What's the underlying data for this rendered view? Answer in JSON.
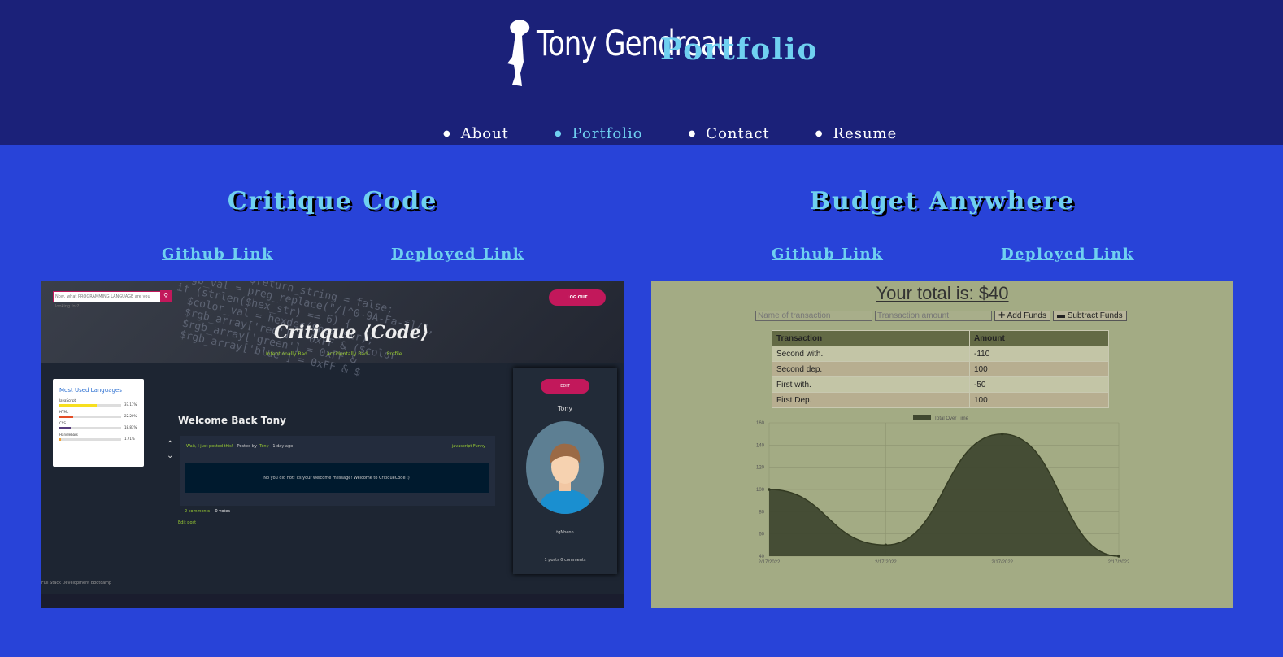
{
  "header": {
    "logo_text": "Tony Gendreau",
    "title": "Portfolio"
  },
  "nav": {
    "items": [
      {
        "label": "About"
      },
      {
        "label": "Portfolio"
      },
      {
        "label": "Contact"
      },
      {
        "label": "Resume"
      }
    ],
    "active": "Portfolio"
  },
  "projects": [
    {
      "title": "Critique Code",
      "github_label": "Github Link",
      "deployed_label": "Deployed Link"
    },
    {
      "title": "Budget Anywhere",
      "github_label": "Github Link",
      "deployed_label": "Deployed Link"
    }
  ],
  "critique_screenshot": {
    "search_placeholder": "Now, what PROGRAMMING LANGUAGE are you looking for?",
    "logout_label": "LOG OUT",
    "brand": "Critique ⟨Code⟩",
    "nav_links": [
      "Intentionally Bad",
      "Accidentally Bad",
      "Profile"
    ],
    "sidebar_title": "Most Used Languages",
    "languages": [
      {
        "name": "JavaScript",
        "pct": "37.17%",
        "fill": 0.6,
        "color": "#f7df1e"
      },
      {
        "name": "HTML",
        "pct": "22.20%",
        "fill": 0.22,
        "color": "#e44d26"
      },
      {
        "name": "CSS",
        "pct": "18.83%",
        "fill": 0.18,
        "color": "#563d7c"
      },
      {
        "name": "Handlebars",
        "pct": "1.71%",
        "fill": 0.03,
        "color": "#f0a030"
      }
    ],
    "welcome": "Welcome Back Tony",
    "post_title": "Wait, I just posted this!",
    "post_by": "Posted by",
    "post_author": "Tony",
    "post_time": "1 day ago",
    "post_tags": "javascript    Funny",
    "post_body": "No you did not! Its your welcome message! Welcome to CritiqueCode :)",
    "comments": "2 comments",
    "votes": "0 votes",
    "edit_post": "Edit post",
    "edit_label": "EDIT",
    "profile_name": "Tony",
    "profile_handle": "tgNbenn",
    "profile_stats": "1 posts 0 comments",
    "footer": "Full Stack Development Bootcamp"
  },
  "budget_screenshot": {
    "total_label": "Your total is: $40",
    "name_placeholder": "Name of transaction",
    "amount_placeholder": "Transaction amount",
    "add_label": "✚ Add Funds",
    "subtract_label": "▬ Subtract Funds",
    "table_headers": [
      "Transaction",
      "Amount"
    ],
    "rows": [
      [
        "Second with.",
        "-110"
      ],
      [
        "Second dep.",
        "100"
      ],
      [
        "First with.",
        "-50"
      ],
      [
        "First Dep.",
        "100"
      ]
    ]
  },
  "chart_data": {
    "type": "area",
    "legend": "Total Over Time",
    "legend_position": "top",
    "x": [
      "2/17/2022",
      "2/17/2022",
      "2/17/2022",
      "2/17/2022"
    ],
    "series": [
      {
        "name": "Total Over Time",
        "values": [
          100,
          50,
          150,
          40
        ]
      }
    ],
    "ylim": [
      40,
      160
    ],
    "yticks": [
      40,
      60,
      80,
      100,
      120,
      140,
      160
    ],
    "grid": true,
    "color": "#404830"
  }
}
